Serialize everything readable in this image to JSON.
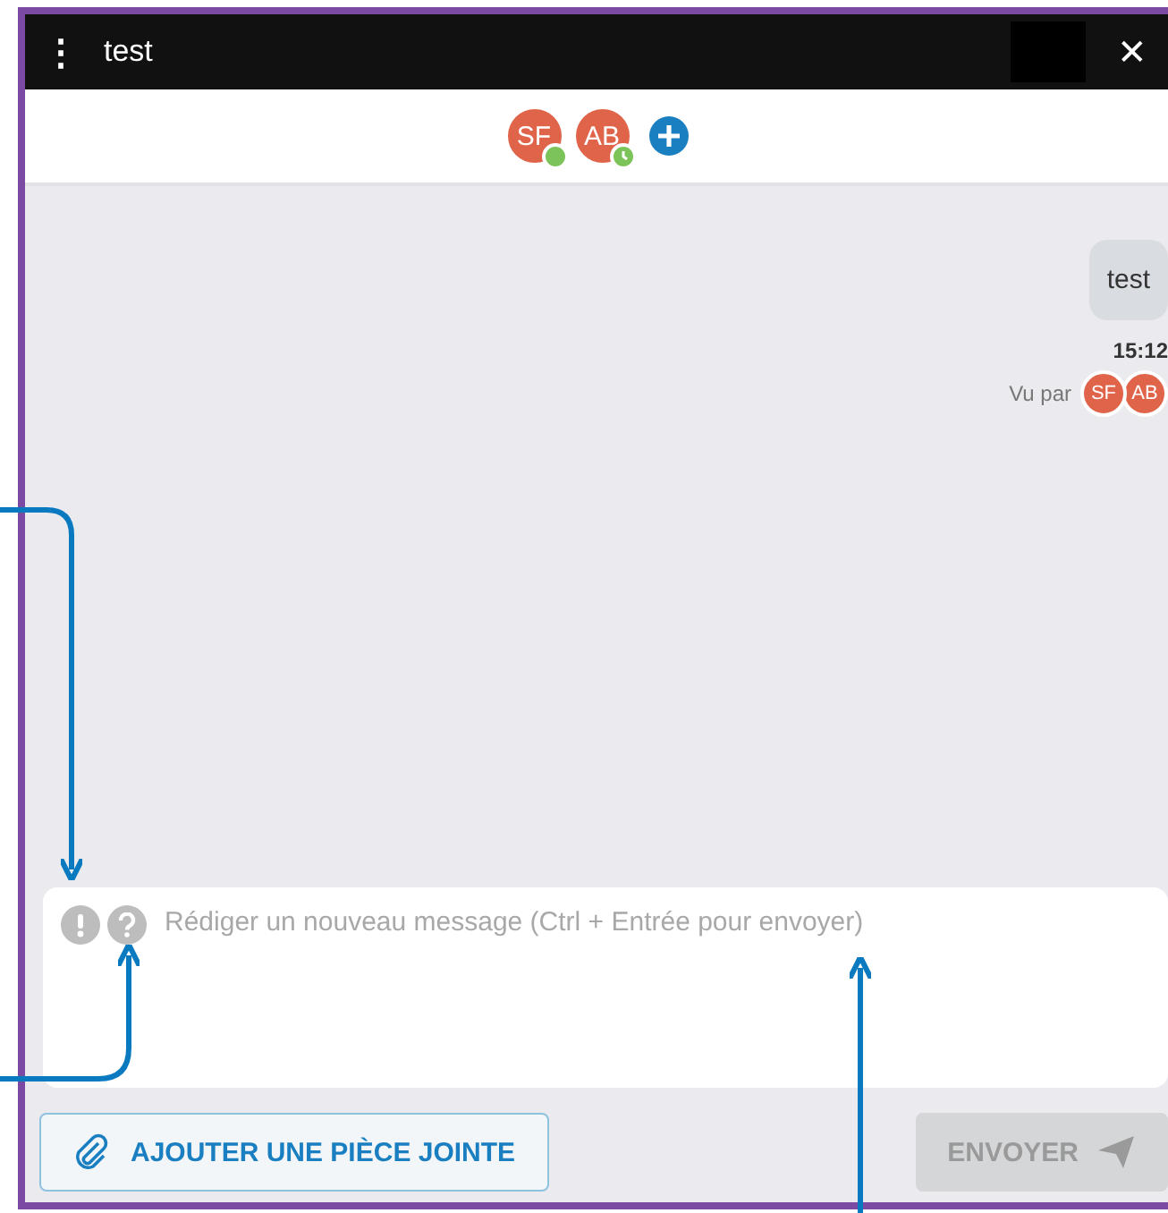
{
  "window": {
    "title": "test",
    "menu_icon": "⋮",
    "close_icon": "✕"
  },
  "participants": [
    {
      "initials": "SF",
      "kind": "online"
    },
    {
      "initials": "AB",
      "kind": "away"
    }
  ],
  "messages": [
    {
      "text": "test",
      "time": "15:12",
      "seen_label": "Vu par",
      "seen_by": [
        "SF",
        "AB"
      ]
    }
  ],
  "composer": {
    "placeholder": "Rédiger un nouveau message (Ctrl + Entrée pour envoyer)"
  },
  "attach_button": {
    "label": "AJOUTER UNE PIÈCE JOINTE"
  },
  "send_button": {
    "label": "ENVOYER",
    "disabled": true
  }
}
